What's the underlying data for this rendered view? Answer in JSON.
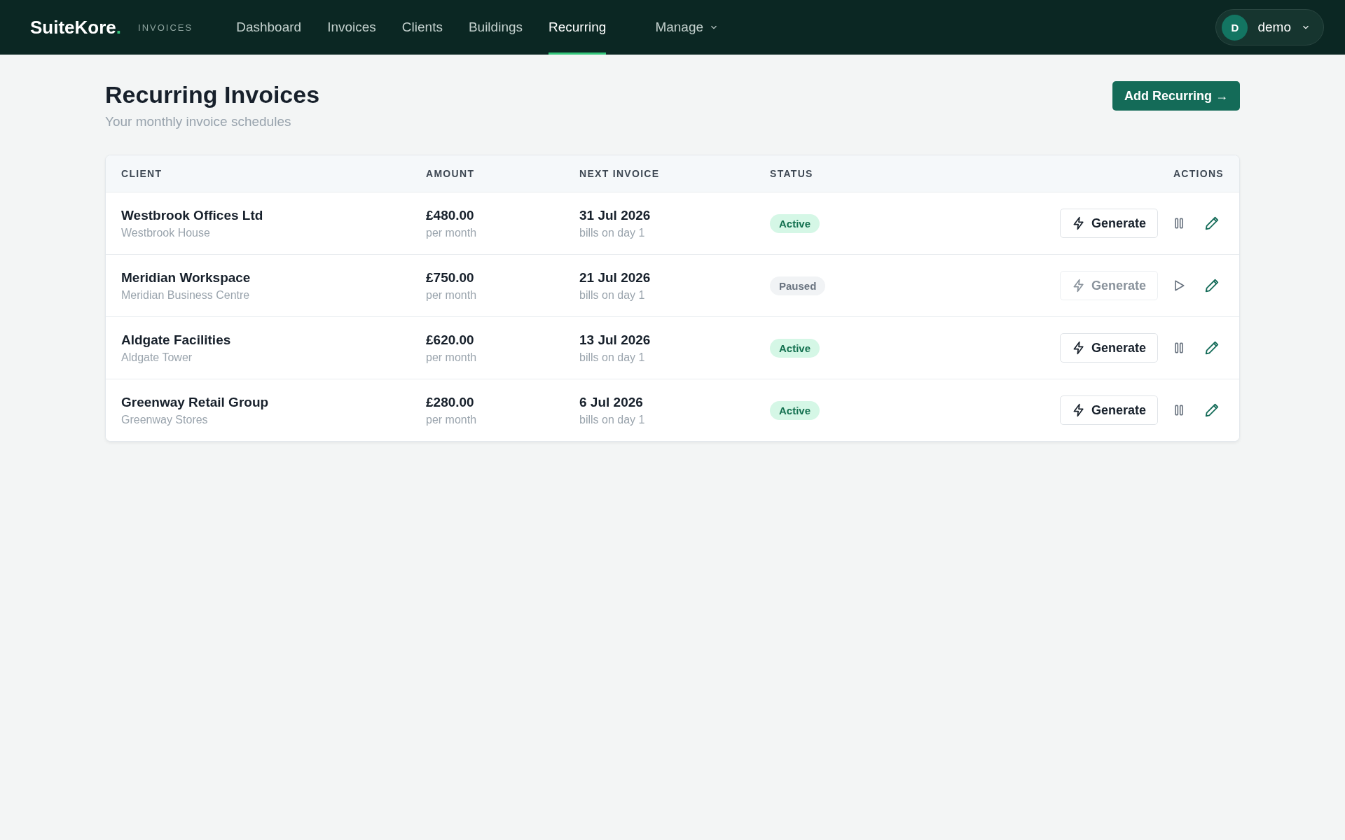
{
  "brand": {
    "name": "SuiteKore",
    "dot": ".",
    "section": "INVOICES"
  },
  "nav": [
    {
      "label": "Dashboard",
      "selected": false
    },
    {
      "label": "Invoices",
      "selected": false
    },
    {
      "label": "Clients",
      "selected": false
    },
    {
      "label": "Buildings",
      "selected": false
    },
    {
      "label": "Recurring",
      "selected": true
    }
  ],
  "manage_menu": {
    "label": "Manage"
  },
  "user": {
    "initial": "D",
    "name": "demo"
  },
  "page": {
    "title": "Recurring Invoices",
    "subtitle": "Your monthly invoice schedules",
    "add_button": "Add Recurring →"
  },
  "table": {
    "columns": [
      "CLIENT",
      "AMOUNT",
      "NEXT INVOICE",
      "STATUS",
      "ACTIONS"
    ],
    "rows": [
      {
        "client": "Westbrook Offices Ltd",
        "building": "Westbrook House",
        "amount": "£480.00",
        "period": "per month",
        "next": "31 Jul 2026",
        "billing": "bills on day 1",
        "status": "Active",
        "paused": false,
        "generate": "Generate"
      },
      {
        "client": "Meridian Workspace",
        "building": "Meridian Business Centre",
        "amount": "£750.00",
        "period": "per month",
        "next": "21 Jul 2026",
        "billing": "bills on day 1",
        "status": "Paused",
        "paused": true,
        "generate": "Generate"
      },
      {
        "client": "Aldgate Facilities",
        "building": "Aldgate Tower",
        "amount": "£620.00",
        "period": "per month",
        "next": "13 Jul 2026",
        "billing": "bills on day 1",
        "status": "Active",
        "paused": false,
        "generate": "Generate"
      },
      {
        "client": "Greenway Retail Group",
        "building": "Greenway Stores",
        "amount": "£280.00",
        "period": "per month",
        "next": "6 Jul 2026",
        "billing": "bills on day 1",
        "status": "Active",
        "paused": false,
        "generate": "Generate"
      }
    ]
  }
}
